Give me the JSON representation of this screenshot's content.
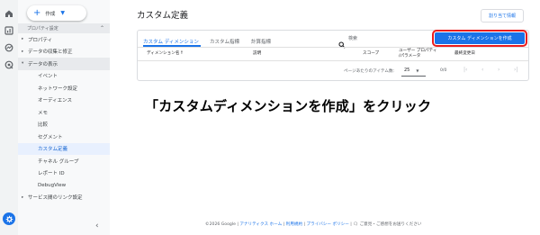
{
  "rail": {
    "icons": [
      "home-icon",
      "reports-icon",
      "explore-icon",
      "advertising-icon"
    ],
    "settings_icon": "gear-icon"
  },
  "sidebar": {
    "create_label": "作成",
    "section_label": "プロパティ設定",
    "items": [
      {
        "label": "プロパティ",
        "level": "top"
      },
      {
        "label": "データの収集と修正",
        "level": "top"
      },
      {
        "label": "データの表示",
        "level": "top",
        "expanded": true
      },
      {
        "label": "イベント",
        "level": "child"
      },
      {
        "label": "ネットワーク設定",
        "level": "child"
      },
      {
        "label": "オーディエンス",
        "level": "child"
      },
      {
        "label": "メモ",
        "level": "child"
      },
      {
        "label": "比較",
        "level": "child"
      },
      {
        "label": "セグメント",
        "level": "child"
      },
      {
        "label": "カスタム定義",
        "level": "child",
        "active": true
      },
      {
        "label": "チャネル グループ",
        "level": "child"
      },
      {
        "label": "レポート ID",
        "level": "child"
      },
      {
        "label": "DebugView",
        "level": "child"
      },
      {
        "label": "サービス間のリンク設定",
        "level": "top"
      }
    ]
  },
  "main": {
    "title": "カスタム定義",
    "ack_button": "割り当て情報",
    "tabs": [
      "カスタム ディメンション",
      "カスタム指標",
      "計算指標"
    ],
    "search_placeholder": "検索",
    "create_button": "カスタム ディメンションを作成",
    "columns": {
      "name": "ディメンション名",
      "description": "説明",
      "scope": "スコープ",
      "user_prop_line1": "ユーザー プロパティ",
      "user_prop_line2": "/パラメータ",
      "last_changed": "最終変更日"
    },
    "pager": {
      "rows_label": "ページあたりのアイテム数:",
      "rows_value": "25",
      "range": "0/0"
    }
  },
  "instruction": "「カスタムディメンションを作成」をクリック",
  "footer": {
    "prefix": "©2026 Google | ",
    "analytics_home": "アナリティクス ホーム",
    "sep1": " | ",
    "terms": "利用規約",
    "sep2": " | ",
    "privacy": "プライバシー ポリシー",
    "feedback": " | 🗨 ご意見・ご感想をお送りください"
  },
  "colors": {
    "accent": "#1a73e8",
    "highlight_border": "#ea1d1d",
    "active_nav_bg": "#e8f0fe"
  }
}
